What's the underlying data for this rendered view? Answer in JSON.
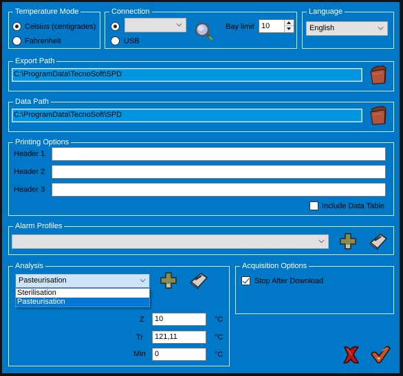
{
  "temperature_mode": {
    "title": "Temperature Mode",
    "options": [
      {
        "label": "Celsius (centigrades)",
        "selected": true
      },
      {
        "label": "Fahrenheit",
        "selected": false
      }
    ]
  },
  "connection": {
    "title": "Connection",
    "port_selected": true,
    "port_value": "",
    "usb_label": "USB",
    "usb_selected": false,
    "search_icon": "magnifier-icon",
    "bay_limit_label": "Bay limit",
    "bay_limit_value": "10"
  },
  "language": {
    "title": "Language",
    "value": "English"
  },
  "export_path": {
    "title": "Export Path",
    "value": "C:\\ProgramData\\TecnoSoft\\SPD",
    "browse_icon": "folder-icon"
  },
  "data_path": {
    "title": "Data Path",
    "value": "C:\\ProgramData\\TecnoSoft\\SPD",
    "browse_icon": "folder-icon"
  },
  "printing_options": {
    "title": "Printing Options",
    "headers": [
      {
        "label": "Header 1",
        "value": ""
      },
      {
        "label": "Header 2",
        "value": ""
      },
      {
        "label": "Header 3",
        "value": ""
      }
    ],
    "include_data_table_label": "Include Data Table",
    "include_data_table": false
  },
  "alarm_profiles": {
    "title": "Alarm Profiles",
    "value": "",
    "add_icon": "plus-icon",
    "erase_icon": "eraser-icon"
  },
  "analysis": {
    "title": "Analysis",
    "value": "Pasteurisation",
    "options": [
      "Sterilisation",
      "Pasteurisation"
    ],
    "highlighted_option": "Pasteurisation",
    "add_icon": "plus-icon",
    "erase_icon": "eraser-icon",
    "fields": [
      {
        "label": "Z",
        "value": "10",
        "unit": "°C"
      },
      {
        "label": "Tr",
        "value": "121,11",
        "unit": "°C"
      },
      {
        "label": "Min",
        "value": "0",
        "unit": "°C"
      }
    ]
  },
  "acquisition_options": {
    "title": "Acquisition Options",
    "stop_after_download_label": "Stop After Download",
    "stop_after_download": true
  },
  "actions": {
    "cancel_icon": "cancel-x-icon",
    "ok_icon": "ok-check-icon"
  },
  "colors": {
    "background": "#0078c8",
    "path_field": "#0095e0",
    "selection": "#0078d7"
  }
}
